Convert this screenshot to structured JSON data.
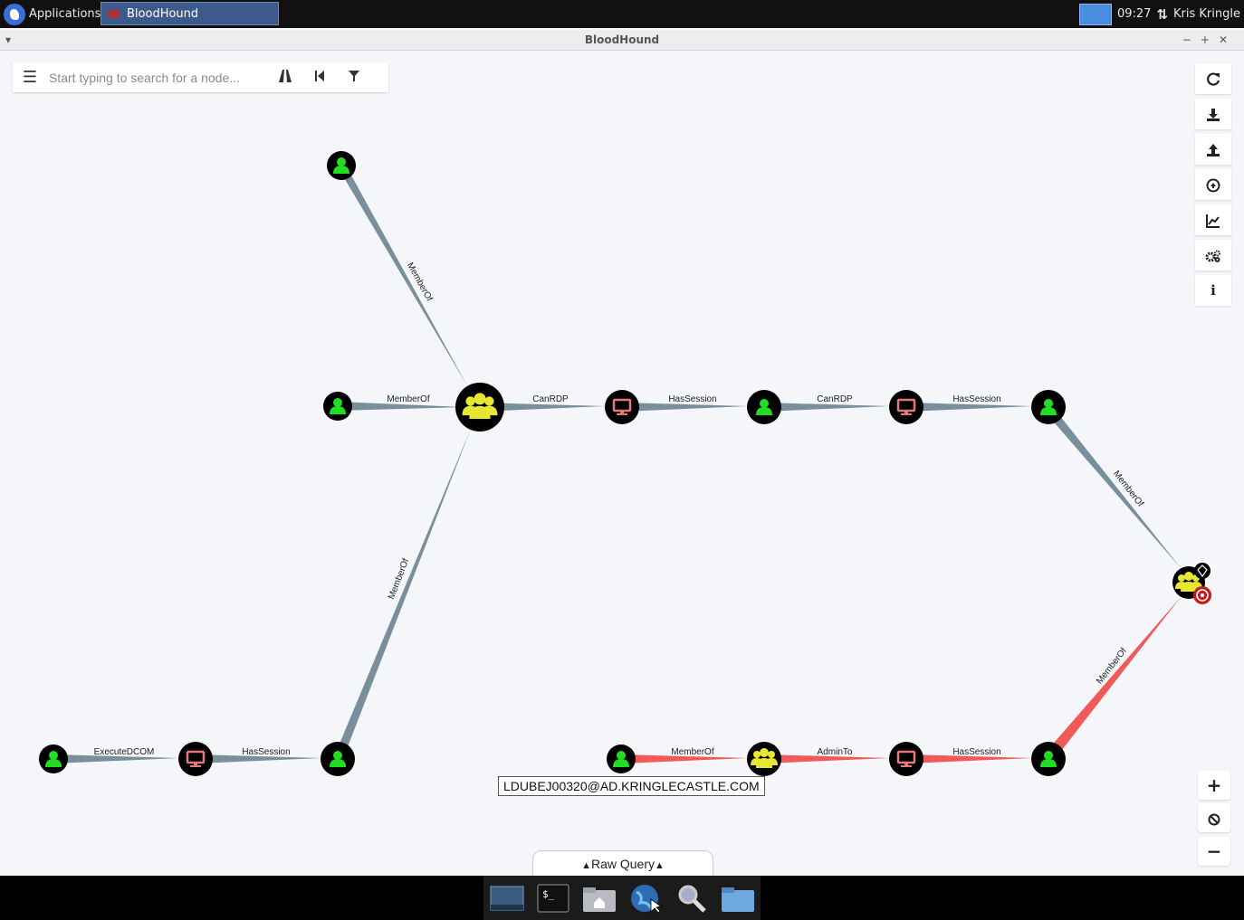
{
  "topbar": {
    "apps_label": "Applications",
    "task_title": "BloodHound",
    "clock": "09:27",
    "user": "Kris Kringle"
  },
  "window": {
    "title": "BloodHound"
  },
  "search": {
    "placeholder": "Start typing to search for a node..."
  },
  "graph": {
    "edges": [
      {
        "label": "MemberOf"
      },
      {
        "label": "MemberOf"
      },
      {
        "label": "CanRDP"
      },
      {
        "label": "HasSession"
      },
      {
        "label": "CanRDP"
      },
      {
        "label": "HasSession"
      },
      {
        "label": "MemberOf"
      },
      {
        "label": "MemberOf"
      },
      {
        "label": "ExecuteDCOM"
      },
      {
        "label": "HasSession"
      },
      {
        "label": "MemberOf"
      },
      {
        "label": "AdminTo"
      },
      {
        "label": "HasSession"
      },
      {
        "label": "MemberOf"
      }
    ],
    "node_label": "LDUBEJ00320@AD.KRINGLECASTLE.COM",
    "colors": {
      "user": "#22dd22",
      "group": "#e6e633",
      "computer": "#e37a7a",
      "edge": "#7a8f9c",
      "path": "#f25a5a"
    }
  },
  "rawquery": {
    "label": "Raw Query"
  },
  "toolbar": {
    "icons": [
      "refresh-icon",
      "download-icon",
      "upload-icon",
      "upload-circle-icon",
      "chart-icon",
      "gears-icon",
      "info-icon"
    ],
    "zoom_in": "+",
    "zoom_out": "−"
  }
}
